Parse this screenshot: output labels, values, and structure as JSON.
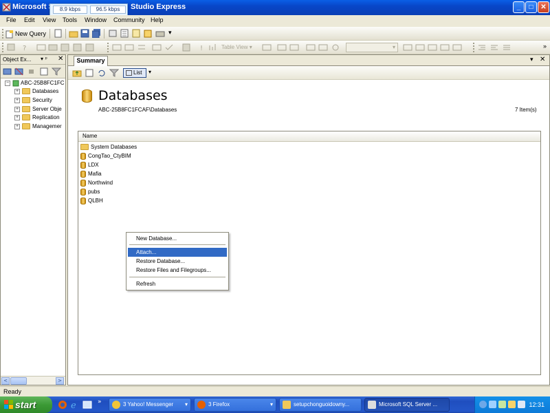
{
  "window": {
    "title_left": "Microsoft S",
    "title_right": "Studio Express",
    "minimize": "_",
    "maximize": "□",
    "close": "✕"
  },
  "net_meter": {
    "down": "8.9 kbps",
    "up": "96.5 kbps"
  },
  "menu": [
    "File",
    "Edit",
    "View",
    "Tools",
    "Window",
    "Community",
    "Help"
  ],
  "toolbar": {
    "new_query": "New Query",
    "table_view": "Table View",
    "overflow": "»"
  },
  "object_explorer": {
    "title": "Object Ex...",
    "pin": "▾ ᵖ",
    "close": "✕",
    "server": "ABC-25B8FC1FC",
    "nodes": [
      "Databases",
      "Security",
      "Server Obje",
      "Replication",
      "Managemer"
    ],
    "expander_plus": "+",
    "expander_minus": "−",
    "scroll_left": "<",
    "scroll_right": ">"
  },
  "summary": {
    "tab_label": "Summary",
    "tab_close": "✕",
    "tab_dropdown": "▾",
    "list_button": "List",
    "list_dropdown": "▾",
    "heading": "Databases",
    "path": "ABC-25B8FC1FCAF\\Databases",
    "item_count": "7 Item(s)",
    "column_name": "Name",
    "items": [
      {
        "name": "System Databases",
        "icon": "folder-icon"
      },
      {
        "name": "CongTao_CtyBIM",
        "icon": "database-icon"
      },
      {
        "name": "LDX",
        "icon": "database-icon"
      },
      {
        "name": "Mafia",
        "icon": "database-icon"
      },
      {
        "name": "Northwind",
        "icon": "database-icon"
      },
      {
        "name": "pubs",
        "icon": "database-icon"
      },
      {
        "name": "QLBH",
        "icon": "database-icon"
      }
    ]
  },
  "context_menu": {
    "items": [
      "New Database...",
      "Attach...",
      "Restore Database...",
      "Restore Files and Filegroups...",
      "Refresh"
    ],
    "selected": "Attach..."
  },
  "status": {
    "text": "Ready"
  },
  "taskbar": {
    "start": "start",
    "quicklaunch_more": "»",
    "tasks": [
      {
        "label": "3 Yahoo! Messenger",
        "arrow": "▾"
      },
      {
        "label": "3 Firefox",
        "arrow": "▾"
      },
      {
        "label": "setupchonguoidowny..."
      },
      {
        "label": "Microsoft SQL Server ..."
      }
    ],
    "clock": "12:31"
  },
  "colors": {
    "titlebar": "#0a5fe6",
    "selection": "#316ac5",
    "taskbar": "#2457c9",
    "start_button": "#3c9a36"
  }
}
